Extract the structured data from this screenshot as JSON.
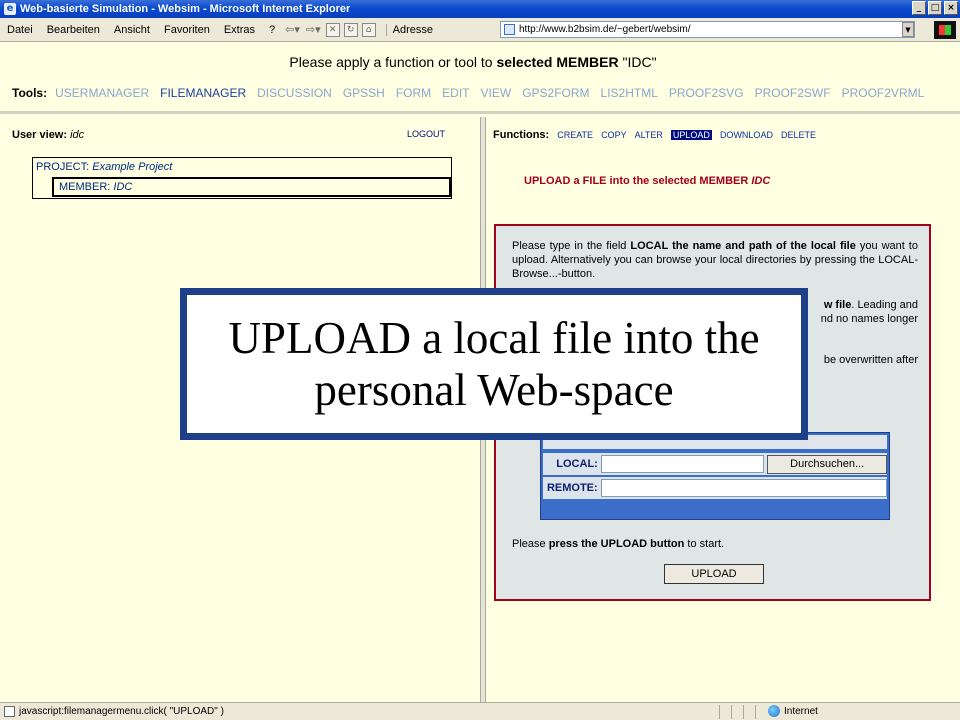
{
  "window": {
    "title": "Web-basierte Simulation - Websim - Microsoft Internet Explorer",
    "controls": [
      "_",
      "□",
      "×"
    ]
  },
  "menubar": {
    "items": [
      "Datei",
      "Bearbeiten",
      "Ansicht",
      "Favoriten",
      "Extras",
      "?"
    ],
    "address_label": "Adresse",
    "address_url": "http://www.b2bsim.de/~gebert/websim/"
  },
  "header": {
    "instruction_prefix": "Please apply a function or tool to ",
    "instruction_bold": "selected MEMBER",
    "instruction_suffix": " \"IDC\"",
    "tools_label": "Tools:",
    "tools": [
      "USERMANAGER",
      "FILEMANAGER",
      "DISCUSSION",
      "GPSSH",
      "FORM",
      "EDIT",
      "VIEW",
      "GPS2FORM",
      "LIS2HTML",
      "PROOF2SVG",
      "PROOF2SWF",
      "PROOF2VRML"
    ],
    "active_tool": "FILEMANAGER"
  },
  "left": {
    "user_view_label": "User view:",
    "user_view_value": "idc",
    "logout": "LOGOUT",
    "project_label": "PROJECT:",
    "project_value": "Example Project",
    "member_label": "MEMBER:",
    "member_value": "IDC"
  },
  "right": {
    "functions_label": "Functions:",
    "functions": [
      "CREATE",
      "COPY",
      "ALTER",
      "UPLOAD",
      "DOWNLOAD",
      "DELETE"
    ],
    "active_function": "UPLOAD",
    "title_prefix": "UPLOAD a FILE into the selected MEMBER",
    "title_member": "IDC",
    "para1_a": "Please type in the field ",
    "para1_b": "LOCAL the name and path of the local file",
    "para1_c": " you want to upload. Alternatively you can browse your local directories by pressing the LOCAL-Browse...-button.",
    "para2_visible_a": "w file",
    "para2_visible_b": ". Leading and",
    "para2_visible_c": "nd no names longer",
    "para3_visible": "be overwritten after",
    "local_label": "LOCAL:",
    "remote_label": "REMOTE:",
    "browse_button": "Durchsuchen...",
    "press_prefix": "Please ",
    "press_bold": "press the UPLOAD button",
    "press_suffix": " to start.",
    "upload_button": "UPLOAD"
  },
  "overlay": {
    "caption": "UPLOAD a local file into the personal Web-space"
  },
  "statusbar": {
    "text": "javascript:filemanagermenu.click( \"UPLOAD\" )",
    "zone": "Internet"
  },
  "colors": {
    "page_bg": "#ffffe1",
    "accent_red": "#a3001f",
    "accent_blue": "#1e3f8a",
    "link_blue": "#0b2ea6",
    "tool_inactive": "#8aa6cf"
  }
}
